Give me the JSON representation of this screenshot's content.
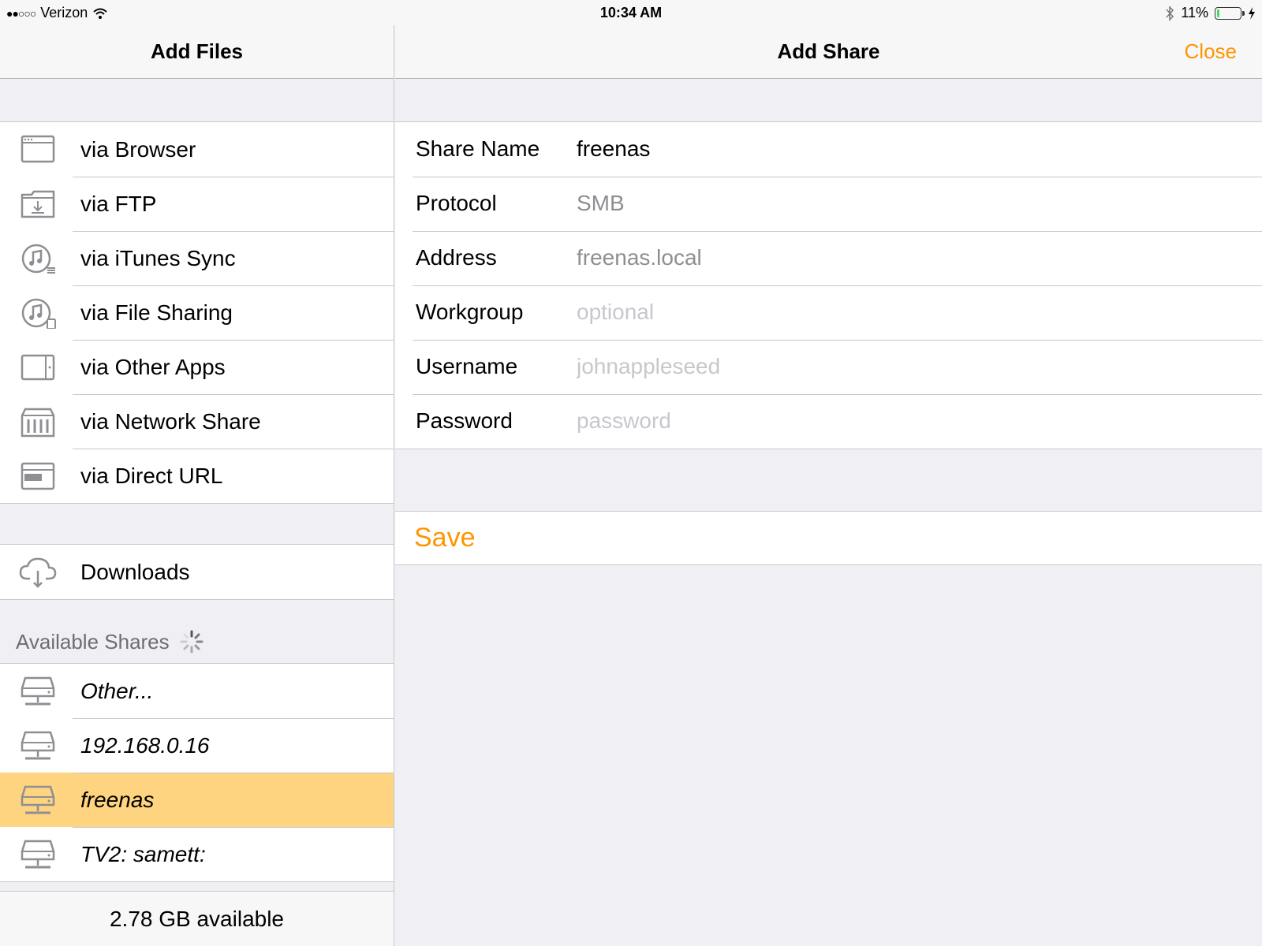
{
  "status_bar": {
    "signal": "●●○○○",
    "carrier": "Verizon",
    "time": "10:34 AM",
    "battery_percent": "11%",
    "battery_level": 0.11
  },
  "left_pane": {
    "title": "Add Files",
    "add_methods": [
      {
        "label": "via Browser",
        "icon": "browser-icon"
      },
      {
        "label": "via FTP",
        "icon": "ftp-folder-icon"
      },
      {
        "label": "via iTunes Sync",
        "icon": "itunes-sync-icon"
      },
      {
        "label": "via File Sharing",
        "icon": "file-sharing-icon"
      },
      {
        "label": "via Other Apps",
        "icon": "other-apps-icon"
      },
      {
        "label": "via Network Share",
        "icon": "network-share-icon"
      },
      {
        "label": "via Direct URL",
        "icon": "direct-url-icon"
      }
    ],
    "downloads": {
      "label": "Downloads",
      "icon": "cloud-download-icon"
    },
    "available_shares_header": "Available Shares",
    "shares": [
      {
        "label": "Other...",
        "selected": false
      },
      {
        "label": "192.168.0.16",
        "selected": false
      },
      {
        "label": "freenas",
        "selected": true
      },
      {
        "label": "TV2: samett:",
        "selected": false
      }
    ],
    "storage_available": "2.78 GB available"
  },
  "right_pane": {
    "title": "Add Share",
    "close_label": "Close",
    "fields": {
      "share_name": {
        "label": "Share Name",
        "value": "freenas"
      },
      "protocol": {
        "label": "Protocol",
        "value": "SMB"
      },
      "address": {
        "label": "Address",
        "value": "freenas.local"
      },
      "workgroup": {
        "label": "Workgroup",
        "placeholder": "optional"
      },
      "username": {
        "label": "Username",
        "placeholder": "johnappleseed"
      },
      "password": {
        "label": "Password",
        "placeholder": "password"
      }
    },
    "save_label": "Save"
  },
  "colors": {
    "accent": "#ff9500",
    "selected_row": "#fed480",
    "background": "#efeff4",
    "separator": "#c8c7cc"
  }
}
